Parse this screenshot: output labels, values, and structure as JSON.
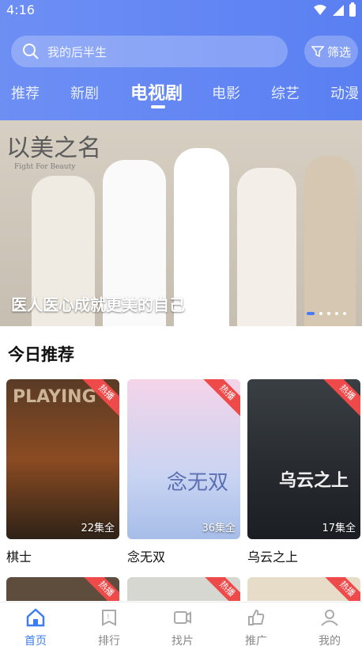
{
  "status": {
    "time": "4:16"
  },
  "search": {
    "placeholder": "我的后半生"
  },
  "filter": {
    "label": "筛选"
  },
  "tabs": [
    {
      "label": "推荐"
    },
    {
      "label": "新剧"
    },
    {
      "label": "电视剧",
      "active": true
    },
    {
      "label": "电影"
    },
    {
      "label": "综艺"
    },
    {
      "label": "动漫"
    }
  ],
  "banner": {
    "logo_title": "以美之名",
    "logo_subtitle": "Fight For Beauty",
    "caption": "医人医心成就更美的自己",
    "slide_index": 1,
    "slide_count": 5
  },
  "section": {
    "title": "今日推荐"
  },
  "cards": [
    {
      "title": "棋士",
      "episodes": "22集全",
      "tag": "热播",
      "poster_text": "PLAYING"
    },
    {
      "title": "念无双",
      "episodes": "36集全",
      "tag": "热播",
      "poster_text": "念无双"
    },
    {
      "title": "乌云之上",
      "episodes": "17集全",
      "tag": "热播",
      "poster_text": "乌云之上"
    }
  ],
  "row2_cards": [
    {
      "tag": "热播"
    },
    {
      "tag": "热播"
    },
    {
      "tag": "热播"
    }
  ],
  "nav": [
    {
      "label": "首页",
      "icon": "home-icon",
      "active": true
    },
    {
      "label": "排行",
      "icon": "rank-icon"
    },
    {
      "label": "找片",
      "icon": "video-icon"
    },
    {
      "label": "推广",
      "icon": "thumb-icon"
    },
    {
      "label": "我的",
      "icon": "user-icon"
    }
  ],
  "colors": {
    "header": "#5a7ff2",
    "accent": "#3d7df3",
    "tag": "#ef4a4a"
  }
}
